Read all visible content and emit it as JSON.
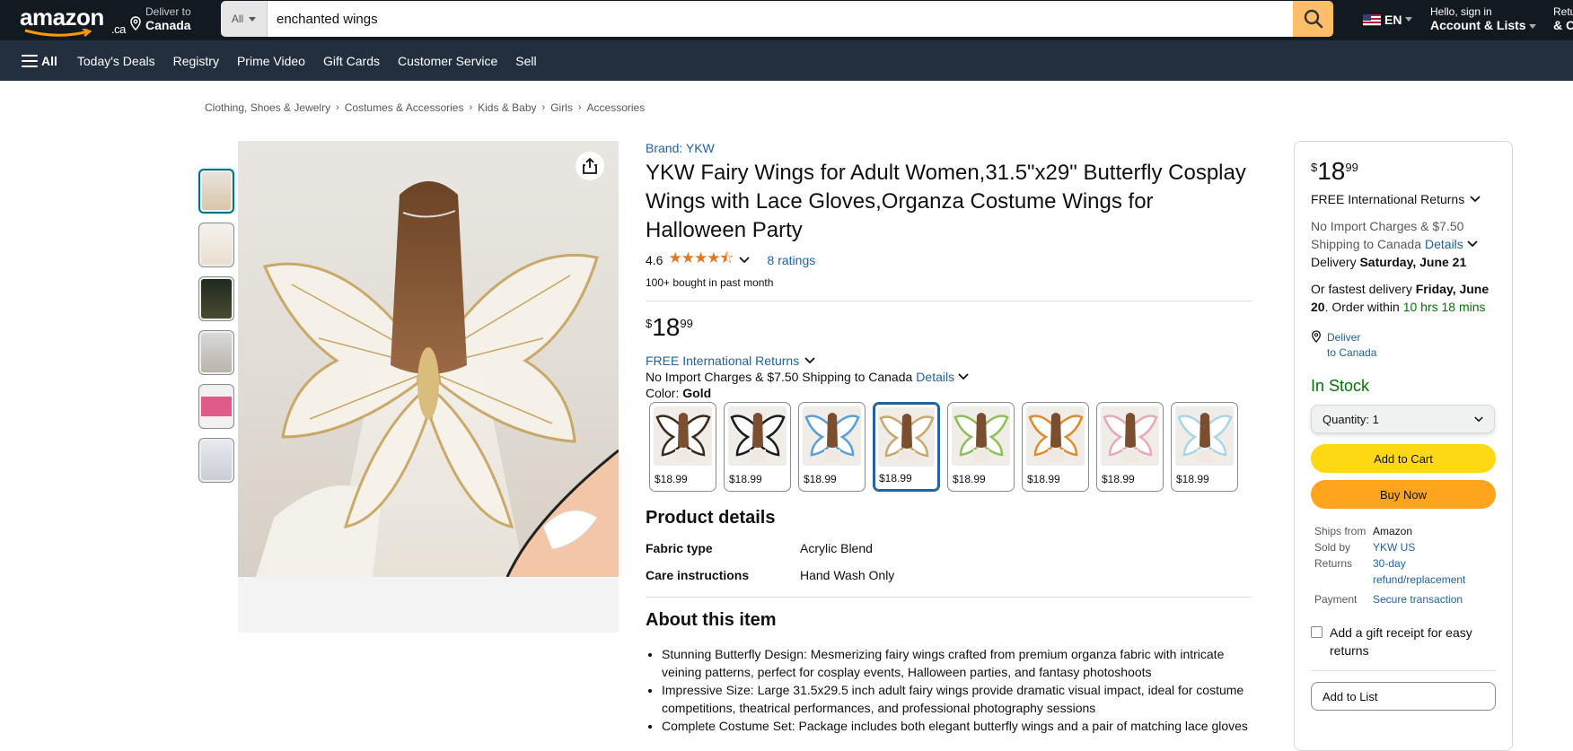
{
  "header": {
    "logo": "amazon",
    "logo_suffix": ".ca",
    "deliver_line1": "Deliver to",
    "deliver_line2": "Canada",
    "search_category": "All",
    "search_value": "enchanted wings",
    "lang": "EN",
    "account_line1": "Hello, sign in",
    "account_line2": "Account & Lists",
    "returns_line1": "Returns",
    "returns_line2": "& Orders"
  },
  "subnav": {
    "all_label": "All",
    "items": [
      "Today's Deals",
      "Registry",
      "Prime Video",
      "Gift Cards",
      "Customer Service",
      "Sell"
    ]
  },
  "breadcrumb": [
    "Clothing, Shoes & Jewelry",
    "Costumes & Accessories",
    "Kids & Baby",
    "Girls",
    "Accessories"
  ],
  "product": {
    "brand": "Brand: YKW",
    "title": "YKW Fairy Wings for Adult Women,31.5\"x29\" Butterfly Cosplay Wings with Lace Gloves,Organza Costume Wings for Halloween Party",
    "rating": "4.6",
    "stars": "★★★★⯪",
    "ratings_count": "8 ratings",
    "bought": "100+ bought in past month",
    "price_symbol": "$",
    "price_whole": "18",
    "price_fraction": "99",
    "returns": "FREE International Returns",
    "import_text": "No Import Charges & $7.50 Shipping to Canada",
    "details": "Details",
    "color_label": "Color:",
    "color_value": "Gold",
    "swatches": [
      {
        "price": "$18.99",
        "color": "#3a2a1e"
      },
      {
        "price": "$18.99",
        "color": "#1b1b1b"
      },
      {
        "price": "$18.99",
        "color": "#5a9fd8"
      },
      {
        "price": "$18.99",
        "color": "#c8a870"
      },
      {
        "price": "$18.99",
        "color": "#8fbf5a"
      },
      {
        "price": "$18.99",
        "color": "#e08a2a"
      },
      {
        "price": "$18.99",
        "color": "#e6a9b8"
      },
      {
        "price": "$18.99",
        "color": "#a9d6e6"
      }
    ],
    "details_heading": "Product details",
    "details_rows": [
      {
        "key": "Fabric type",
        "value": "Acrylic Blend"
      },
      {
        "key": "Care instructions",
        "value": "Hand Wash Only"
      }
    ],
    "about_heading": "About this item",
    "bullets": [
      "Stunning Butterfly Design: Mesmerizing fairy wings crafted from premium organza fabric with intricate veining patterns, perfect for cosplay events, Halloween parties, and fantasy photoshoots",
      "Impressive Size: Large 31.5x29.5 inch adult fairy wings provide dramatic visual impact, ideal for costume competitions, theatrical performances, and professional photography sessions",
      "Complete Costume Set: Package includes both elegant butterfly wings and a pair of matching lace gloves"
    ]
  },
  "buybox": {
    "price_symbol": "$",
    "price_whole": "18",
    "price_fraction": "99",
    "returns": "FREE International Returns",
    "import_line1": "No Import Charges & $7.50",
    "import_line2": "Shipping to Canada",
    "details": "Details",
    "delivery_prefix": "Delivery",
    "delivery_date": "Saturday, June 21",
    "fastest_prefix": "Or fastest delivery",
    "fastest_date": "Friday, June 20",
    "order_within": ". Order within",
    "countdown": "10 hrs 18 mins",
    "deliver_line1": "Deliver",
    "deliver_line2": "to Canada",
    "stock": "In Stock",
    "quantity": "Quantity:  1",
    "add_to_cart": "Add to Cart",
    "buy_now": "Buy Now",
    "ships_from_label": "Ships from",
    "ships_from": "Amazon",
    "sold_by_label": "Sold by",
    "sold_by": "YKW US",
    "returns_label": "Returns",
    "returns_value": "30-day refund/replacement",
    "payment_label": "Payment",
    "payment_value": "Secure transaction",
    "gift": "Add a gift receipt for easy returns",
    "add_to_list": "Add to List"
  },
  "colors": {
    "nav_top": "#131921",
    "nav_sub": "#232f3e",
    "search_button": "#febd69",
    "cart": "#ffd814",
    "buy": "#ffa41c",
    "link": "#2162a1",
    "star": "#de7921",
    "stock": "#007600"
  }
}
